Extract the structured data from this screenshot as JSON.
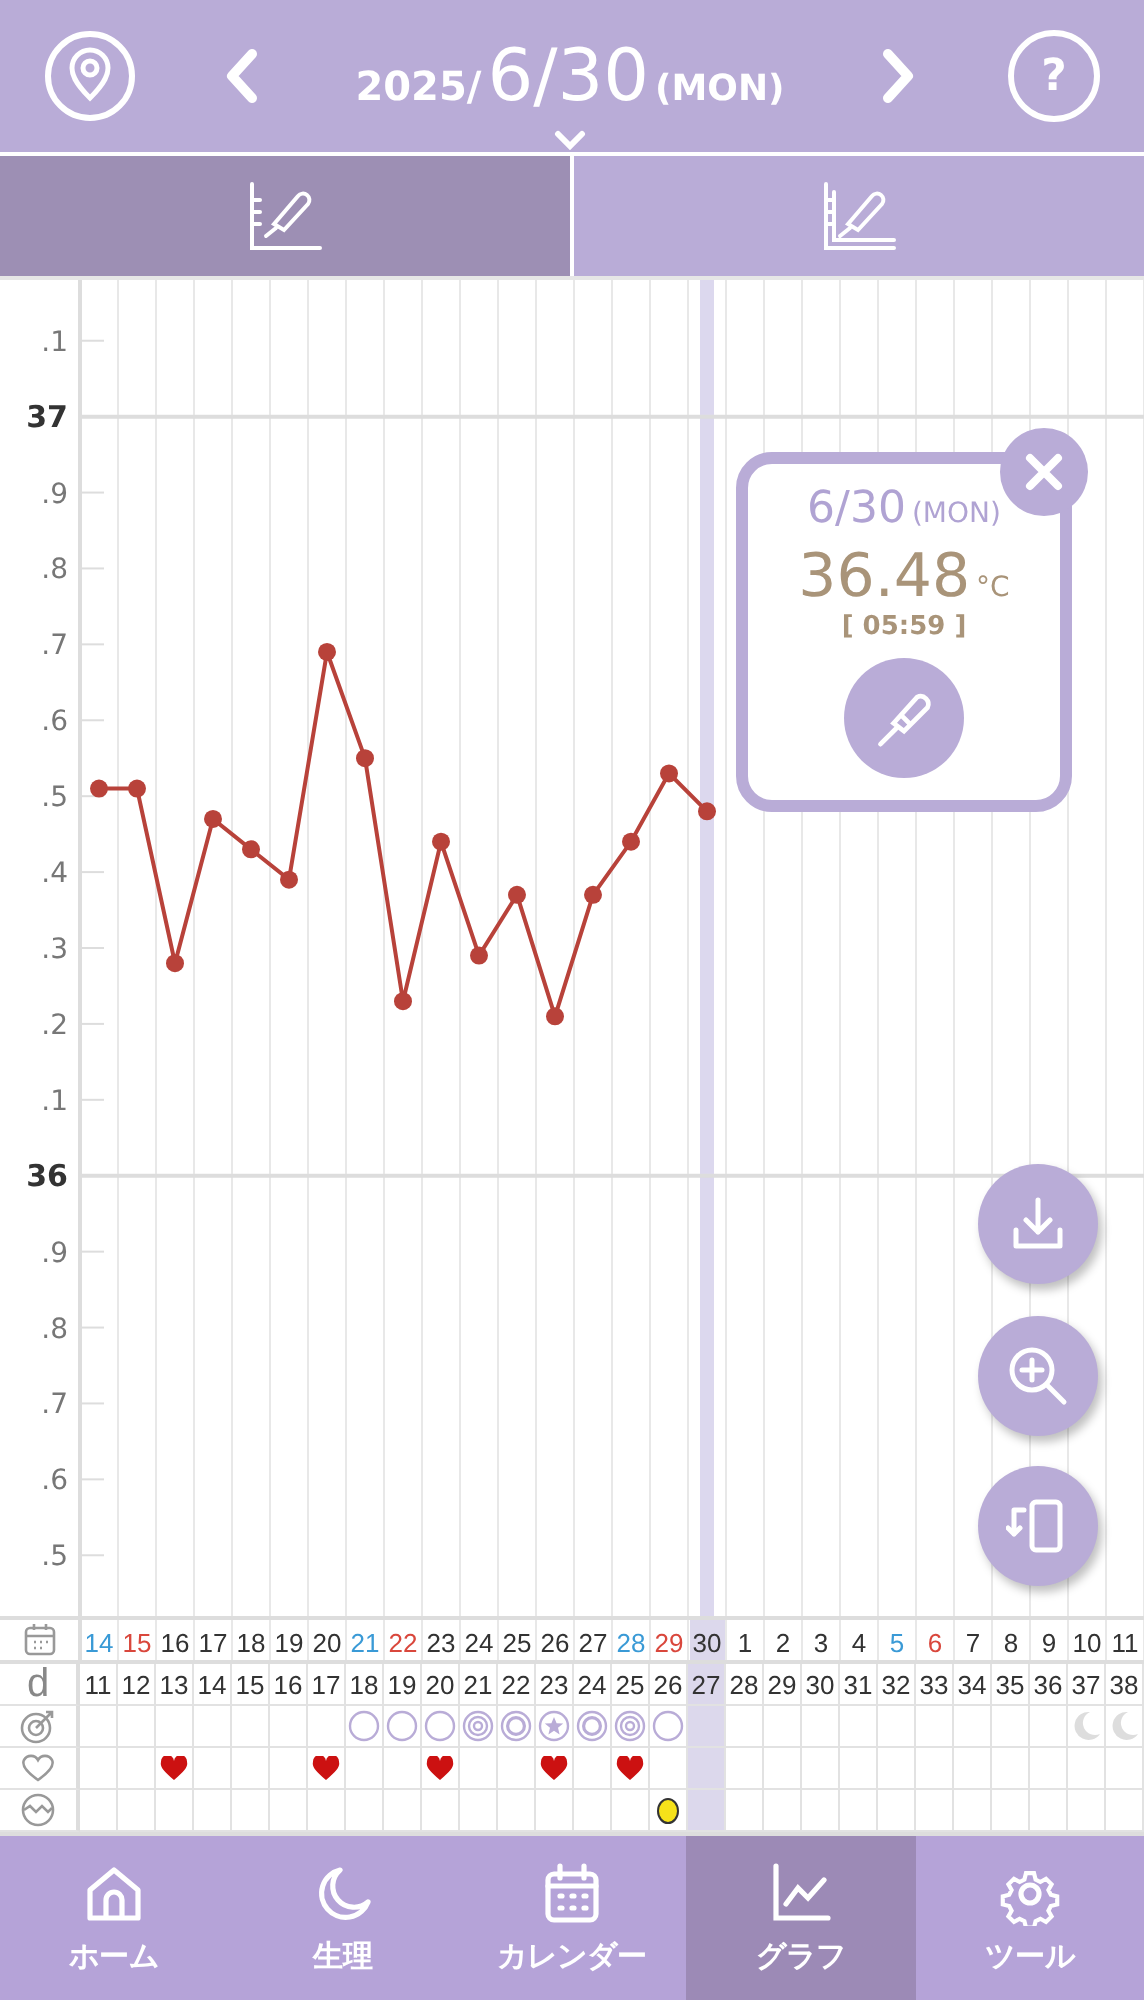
{
  "header": {
    "year": "2025/",
    "date": "6/30",
    "weekday": "(MON)",
    "help": "?"
  },
  "tabs": [
    {
      "selected": true
    },
    {
      "selected": false
    }
  ],
  "chart": {
    "chart_data": {
      "type": "line",
      "categories": [
        "14",
        "15",
        "16",
        "17",
        "18",
        "19",
        "20",
        "21",
        "22",
        "23",
        "24",
        "25",
        "26",
        "27",
        "28",
        "29",
        "30",
        "1",
        "2",
        "3",
        "4",
        "5",
        "6",
        "7",
        "8",
        "9",
        "10",
        "11"
      ],
      "series": [
        {
          "color": "#b8423a",
          "marker": "circle",
          "values": [
            36.51,
            36.51,
            36.28,
            36.47,
            36.43,
            36.39,
            36.69,
            36.55,
            36.23,
            36.44,
            36.29,
            36.37,
            36.21,
            36.37,
            36.44,
            36.53,
            36.48,
            null,
            null,
            null,
            null,
            null,
            null,
            null,
            null,
            null,
            null,
            null
          ]
        }
      ],
      "ylim": [
        35.42,
        37.18
      ],
      "yticks": [
        37,
        36
      ]
    },
    "minor_tick_labels": [
      ".1",
      ".9",
      ".8",
      ".7",
      ".6",
      ".5",
      ".4",
      ".3",
      ".2",
      ".1",
      ".9",
      ".8",
      ".7",
      ".6",
      ".5"
    ],
    "popup": {
      "date": "6/30",
      "weekday": "(MON)",
      "temperature": "36.48",
      "unit": "°C",
      "time": "[ 05:59 ]"
    }
  },
  "table": {
    "cycle_label": "d",
    "days": [
      {
        "color": "#3a9ad6",
        "cycle_day": "11",
        "kind": "none",
        "heart": false,
        "egg": false,
        "selected": false
      },
      {
        "color": "#d9473c",
        "cycle_day": "12",
        "kind": "none",
        "heart": false,
        "egg": false,
        "selected": false
      },
      {
        "color": "#333333",
        "cycle_day": "13",
        "kind": "none",
        "heart": true,
        "egg": false,
        "selected": false
      },
      {
        "color": "#333333",
        "cycle_day": "14",
        "kind": "none",
        "heart": false,
        "egg": false,
        "selected": false
      },
      {
        "color": "#333333",
        "cycle_day": "15",
        "kind": "none",
        "heart": false,
        "egg": false,
        "selected": false
      },
      {
        "color": "#333333",
        "cycle_day": "16",
        "kind": "none",
        "heart": false,
        "egg": false,
        "selected": false
      },
      {
        "color": "#333333",
        "cycle_day": "17",
        "kind": "none",
        "heart": true,
        "egg": false,
        "selected": false
      },
      {
        "color": "#3a9ad6",
        "cycle_day": "18",
        "kind": "circle",
        "heart": false,
        "egg": false,
        "selected": false
      },
      {
        "color": "#d9473c",
        "cycle_day": "19",
        "kind": "circle",
        "heart": false,
        "egg": false,
        "selected": false
      },
      {
        "color": "#333333",
        "cycle_day": "20",
        "kind": "circle",
        "heart": true,
        "egg": false,
        "selected": false
      },
      {
        "color": "#333333",
        "cycle_day": "21",
        "kind": "target",
        "heart": false,
        "egg": false,
        "selected": false
      },
      {
        "color": "#333333",
        "cycle_day": "22",
        "kind": "ring",
        "heart": false,
        "egg": false,
        "selected": false
      },
      {
        "color": "#333333",
        "cycle_day": "23",
        "kind": "star",
        "heart": true,
        "egg": false,
        "selected": false
      },
      {
        "color": "#333333",
        "cycle_day": "24",
        "kind": "ring",
        "heart": false,
        "egg": false,
        "selected": false
      },
      {
        "color": "#3a9ad6",
        "cycle_day": "25",
        "kind": "target",
        "heart": true,
        "egg": false,
        "selected": false
      },
      {
        "color": "#d9473c",
        "cycle_day": "26",
        "kind": "circle",
        "heart": false,
        "egg": true,
        "selected": false
      },
      {
        "color": "#333333",
        "cycle_day": "27",
        "kind": "none",
        "heart": false,
        "egg": false,
        "selected": true
      },
      {
        "color": "#333333",
        "cycle_day": "28",
        "kind": "none",
        "heart": false,
        "egg": false,
        "selected": false
      },
      {
        "color": "#333333",
        "cycle_day": "29",
        "kind": "none",
        "heart": false,
        "egg": false,
        "selected": false
      },
      {
        "color": "#333333",
        "cycle_day": "30",
        "kind": "none",
        "heart": false,
        "egg": false,
        "selected": false
      },
      {
        "color": "#333333",
        "cycle_day": "31",
        "kind": "none",
        "heart": false,
        "egg": false,
        "selected": false
      },
      {
        "color": "#3a9ad6",
        "cycle_day": "32",
        "kind": "none",
        "heart": false,
        "egg": false,
        "selected": false
      },
      {
        "color": "#d9473c",
        "cycle_day": "33",
        "kind": "none",
        "heart": false,
        "egg": false,
        "selected": false
      },
      {
        "color": "#333333",
        "cycle_day": "34",
        "kind": "none",
        "heart": false,
        "egg": false,
        "selected": false
      },
      {
        "color": "#333333",
        "cycle_day": "35",
        "kind": "none",
        "heart": false,
        "egg": false,
        "selected": false
      },
      {
        "color": "#333333",
        "cycle_day": "36",
        "kind": "none",
        "heart": false,
        "egg": false,
        "selected": false
      },
      {
        "color": "#333333",
        "cycle_day": "37",
        "kind": "moon",
        "heart": false,
        "egg": false,
        "selected": false
      },
      {
        "color": "#333333",
        "cycle_day": "38",
        "kind": "moon",
        "heart": false,
        "egg": false,
        "selected": false
      }
    ]
  },
  "nav": [
    {
      "label": "ホーム",
      "selected": false
    },
    {
      "label": "生理",
      "selected": false
    },
    {
      "label": "カレンダー",
      "selected": false
    },
    {
      "label": "グラフ",
      "selected": true
    },
    {
      "label": "ツール",
      "selected": false
    }
  ]
}
